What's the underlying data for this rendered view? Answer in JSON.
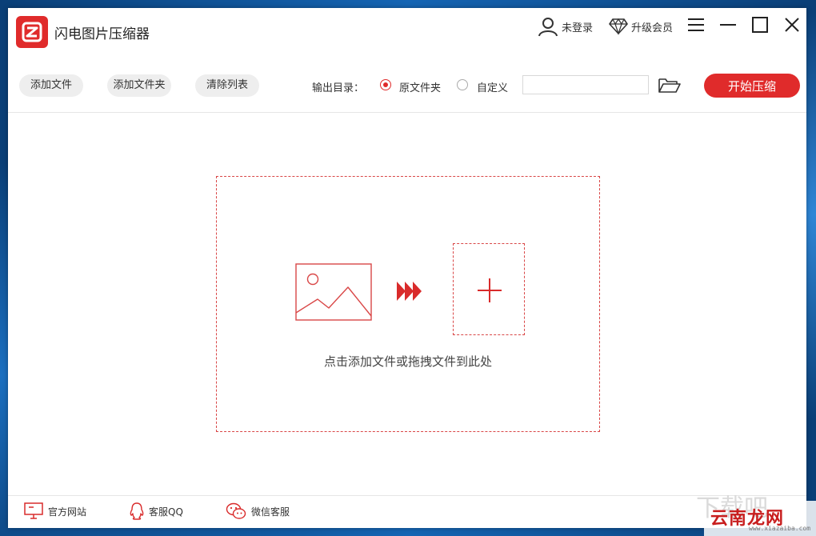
{
  "window": {
    "title": "闪电图片压缩器"
  },
  "header": {
    "user_label": "未登录",
    "vip_label": "升级会员"
  },
  "toolbar": {
    "add_file": "添加文件",
    "add_folder": "添加文件夹",
    "clear_list": "清除列表",
    "output_label": "输出目录：",
    "option_original": "原文件夹",
    "option_custom": "自定义",
    "selected_option": "原文件夹",
    "path_value": "",
    "start_button": "开始压缩"
  },
  "dropzone": {
    "hint": "点击添加文件或拖拽文件到此处"
  },
  "footer": {
    "website": "官方网站",
    "qq": "客服QQ",
    "wechat": "微信客服"
  },
  "watermark": {
    "text": "云南龙网",
    "ghost": "下载吧",
    "url": "www.xiazaiba.com"
  },
  "colors": {
    "accent": "#e02b2b",
    "dashed_border": "#d94747",
    "pill_bg": "#eeeeee"
  }
}
